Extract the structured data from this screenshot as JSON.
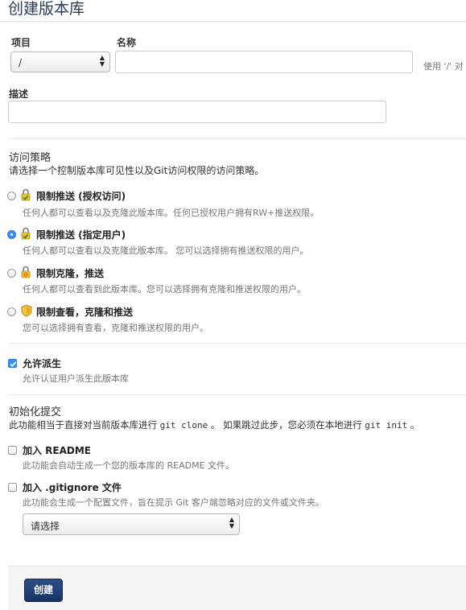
{
  "page": {
    "title": "创建版本库"
  },
  "project": {
    "label": "项目",
    "selected": "/"
  },
  "name": {
    "label": "名称",
    "value": "",
    "hint": "使用 '/' 对"
  },
  "description": {
    "label": "描述",
    "value": ""
  },
  "access": {
    "title": "访问策略",
    "description": "请选择一个控制版本库可见性以及Git访问权限的访问策略。",
    "options": [
      {
        "label": "限制推送 (授权访问)",
        "description": "任何人都可以查看以及克隆此版本库。任何已授权用户拥有RW+推送权限。",
        "icon": "green-lock-icon",
        "checked": false
      },
      {
        "label": "限制推送 (指定用户)",
        "description": "任何人都可以查看以及克隆此版本库。 您可以选择拥有推送权限的用户。",
        "icon": "green-lock-icon",
        "checked": true
      },
      {
        "label": "限制克隆，推送",
        "description": "任何人都可以查看到此版本库。您可以选择拥有克隆和推送权限的用户。",
        "icon": "orange-lock-icon",
        "checked": false
      },
      {
        "label": "限制查看，克隆和推送",
        "description": "您可以选择拥有查看，克隆和推送权限的用户。",
        "icon": "shield-icon",
        "checked": false
      }
    ]
  },
  "fork": {
    "label": "允许派生",
    "description": "允许认证用户派生此版本库",
    "checked": true
  },
  "init": {
    "title": "初始化提交",
    "desc_part1": "此功能相当于直接对当前版本库进行 ",
    "cmd_clone": "git clone",
    "desc_part2": " 。 如果跳过此步，您必须在本地进行 ",
    "cmd_init": "git init",
    "desc_part3": " 。",
    "readme": {
      "label": "加入 README",
      "description": "此功能会自动生成一个您的版本库的 README 文件。",
      "checked": false
    },
    "gitignore": {
      "label": "加入 .gitignore 文件",
      "description": "此功能会生成一个配置文件，旨在提示 Git 客户端忽略对应的文件或文件夹。",
      "checked": false,
      "select_value": "请选择"
    }
  },
  "actions": {
    "create_label": "创建"
  },
  "colors": {
    "title": "#2a3b55",
    "create_button": "#1f3d70",
    "checked_control": "#3d8ee8"
  }
}
